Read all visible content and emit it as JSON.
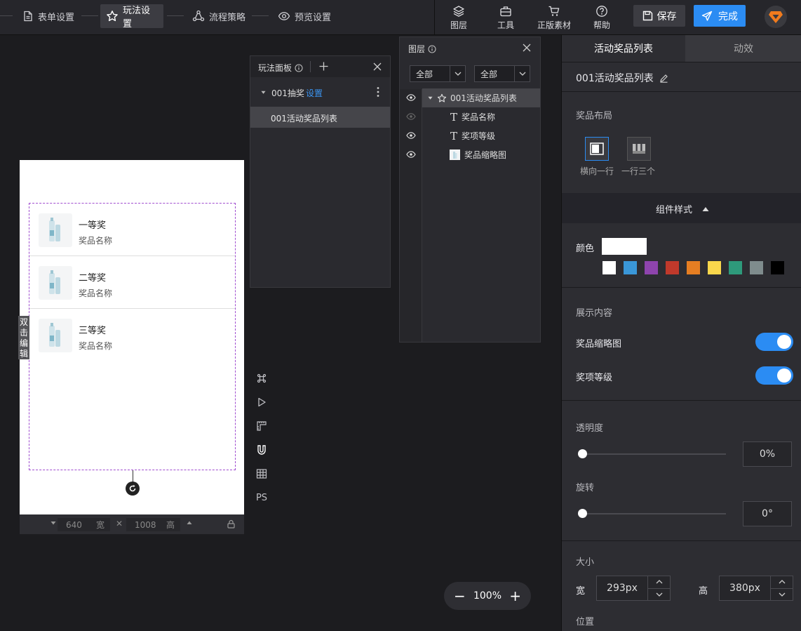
{
  "topbar": {
    "steps": [
      {
        "label": "表单设置",
        "icon": "document-icon"
      },
      {
        "label": "玩法设置",
        "icon": "star-outline-icon"
      },
      {
        "label": "流程策略",
        "icon": "flow-icon"
      },
      {
        "label": "预览设置",
        "icon": "eye-icon"
      }
    ],
    "tools": [
      {
        "label": "图层",
        "icon": "layers-icon"
      },
      {
        "label": "工具",
        "icon": "toolbox-icon"
      },
      {
        "label": "正版素材",
        "icon": "cart-icon"
      },
      {
        "label": "帮助",
        "icon": "help-icon"
      }
    ],
    "save_label": "保存",
    "done_label": "完成"
  },
  "canvas": {
    "double_click_edit": "双击编辑",
    "prizes": [
      {
        "level": "一等奖",
        "name": "奖品名称"
      },
      {
        "level": "二等奖",
        "name": "奖品名称"
      },
      {
        "level": "三等奖",
        "name": "奖品名称"
      }
    ],
    "width_value": "640",
    "width_unit": "宽",
    "height_value": "1008",
    "height_unit": "高",
    "times": "✕"
  },
  "vtools": {
    "ps_label": "PS"
  },
  "play_panel": {
    "title": "玩法面板",
    "group_label": "001抽奖",
    "group_link": "设置",
    "item_label": "001活动奖品列表"
  },
  "layer_panel": {
    "title": "图层",
    "filter1": "全部",
    "filter2": "全部",
    "layers": [
      {
        "label": "001活动奖品列表",
        "icon": "star-outline-icon"
      },
      {
        "label": "奖品名称",
        "icon": "text-icon"
      },
      {
        "label": "奖项等级",
        "icon": "text-icon"
      },
      {
        "label": "奖品缩略图",
        "icon": "image-icon"
      }
    ]
  },
  "zoom": {
    "value": "100%",
    "minus": "−",
    "plus": "+"
  },
  "right_panel": {
    "tab_active": "活动奖品列表",
    "tab_other": "动效",
    "component_name": "001活动奖品列表",
    "layout_label": "奖品布局",
    "layout_options": [
      "横向一行",
      "一行三个"
    ],
    "style_header": "组件样式",
    "color_label": "颜色",
    "color_value": "#ffffff",
    "swatches": [
      "#ffffff",
      "#3a97d8",
      "#8e44ad",
      "#c0392b",
      "#e67e22",
      "#f9d74c",
      "#2e9a7b",
      "#7f8c8d",
      "#000000"
    ],
    "display_label": "展示内容",
    "toggle1_label": "奖品缩略图",
    "toggle1_on": true,
    "toggle2_label": "奖项等级",
    "toggle2_on": true,
    "opacity_label": "透明度",
    "opacity_value": "0%",
    "rotate_label": "旋转",
    "rotate_value": "0°",
    "size_label": "大小",
    "width_label": "宽",
    "width_value": "293px",
    "height_label": "高",
    "height_value": "380px",
    "position_label": "位置"
  },
  "colors": {
    "accent": "#2b8cf3",
    "selection": "#a04dd0",
    "panel": "#2d2d32",
    "background": "#1c1c1f"
  }
}
